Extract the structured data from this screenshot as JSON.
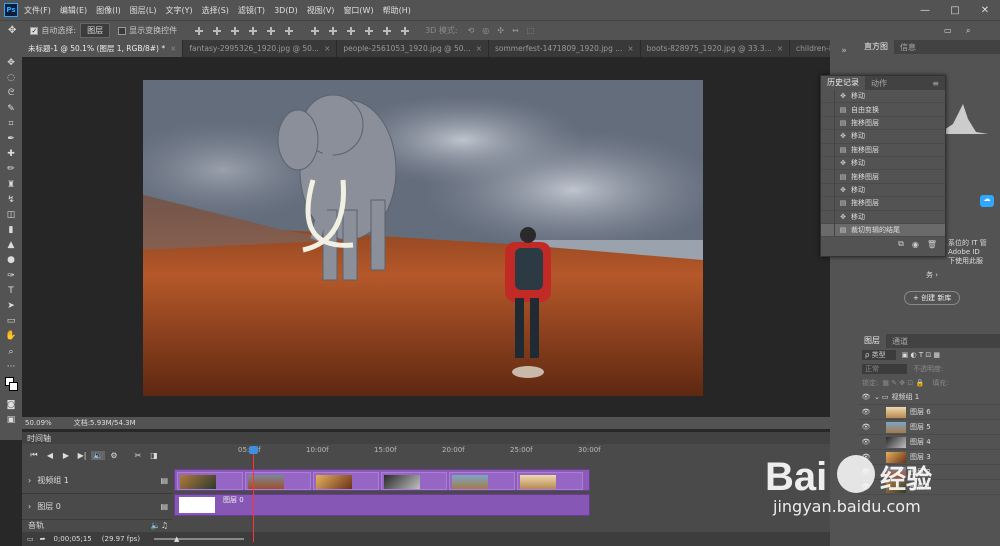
{
  "app": {
    "logo": "Ps"
  },
  "menubar": [
    "文件(F)",
    "编辑(E)",
    "图像(I)",
    "图层(L)",
    "文字(Y)",
    "选择(S)",
    "滤镜(T)",
    "3D(D)",
    "视图(V)",
    "窗口(W)",
    "帮助(H)"
  ],
  "window_controls": {
    "minimize": "—",
    "restore": "□",
    "close": "✕"
  },
  "options": {
    "auto_select_label": "自动选择:",
    "auto_select_value": "图层",
    "show_transform_label": "显示变换控件",
    "mode_3d": "3D 模式:"
  },
  "tabs": [
    {
      "label": "未标题-1 @ 50.1% (图层 1, RGB/8#) *",
      "active": true
    },
    {
      "label": "fantasy-2995326_1920.jpg @ 50...",
      "active": false
    },
    {
      "label": "people-2561053_1920.jpg @ 50...",
      "active": false
    },
    {
      "label": "sommerfest-1471809_1920.jpg ...",
      "active": false
    },
    {
      "label": "boots-828975_1920.jpg @ 33.3...",
      "active": false
    },
    {
      "label": "children-817365_1920.jpg @ 33...",
      "active": false
    }
  ],
  "tab_close": "×",
  "status": {
    "zoom": "50.09%",
    "doc": "文档:5.93M/54.3M"
  },
  "timeline": {
    "header": "时间轴",
    "ruler": [
      "05:00f",
      "10:00f",
      "15:00f",
      "20:00f",
      "25:00f",
      "30:00f"
    ],
    "tracks": [
      {
        "name": "视频组 1"
      },
      {
        "name": "图层 0"
      }
    ],
    "layer0_clip": "图层 0",
    "audio_label": "音轨",
    "timecode": "0;00;05;15",
    "fps": "(29.97 fps)"
  },
  "right_panel": {
    "tabs": [
      "直方图",
      "信息"
    ],
    "text_lines": [
      "系位的 IT 管",
      "Adobe ID",
      "下使用此服"
    ],
    "text_tail": "务 ›",
    "create_library_button": "+ 创建 新库",
    "layers_tabs": [
      "图层",
      "通道"
    ],
    "kind_select": "ρ 类型",
    "blend_mode": "正常",
    "opacity_label": "不透明度:",
    "lock_label": "锁定:",
    "fill_label": "填充:",
    "layers": [
      {
        "name": "视频组 1",
        "group": true
      },
      {
        "name": "图层 6"
      },
      {
        "name": "图层 5"
      },
      {
        "name": "图层 4"
      },
      {
        "name": "图层 3"
      },
      {
        "name": "图层 2"
      },
      {
        "name": "图层 1"
      }
    ]
  },
  "history": {
    "tabs": [
      "历史记录",
      "动作"
    ],
    "items": [
      "移动",
      "自由变换",
      "拖移图层",
      "移动",
      "拖移图层",
      "移动",
      "拖移图层",
      "移动",
      "拖移图层",
      "移动",
      "裁切剪辑的结尾"
    ],
    "selected_index": 10
  },
  "watermark": {
    "brand": "Bai",
    "brand2": "经验",
    "url": "jingyan.baidu.com"
  }
}
